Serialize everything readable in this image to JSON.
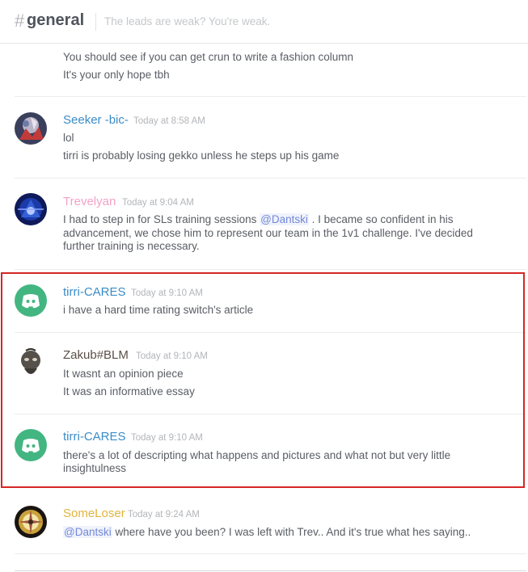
{
  "header": {
    "hash": "#",
    "channel": "general",
    "topic": "The leads are weak? You're weak."
  },
  "colors": {
    "highlight_border": "#d62626",
    "seeker": "#3b8cc7",
    "trevelyan": "#f2a2c7",
    "tirri": "#3b8cc7",
    "zakub": "#5a4e47",
    "someloser": "#e0b43a",
    "mention": "#7289da"
  },
  "messages": [
    {
      "lines": [
        "You should see if you can get crun to write a fashion column",
        "It's your only hope tbh"
      ]
    },
    {
      "username": "Seeker -bic-",
      "timestamp": "Today at 8:58 AM",
      "avatar_icon": "seeker-avatar",
      "lines": [
        "lol",
        "tirri is probably losing gekko unless he steps up his game"
      ]
    },
    {
      "username": "Trevelyan",
      "timestamp": "Today at 9:04 AM",
      "avatar_icon": "trevelyan-avatar",
      "text_pre": "I had to step in for SLs training sessions ",
      "mention": "@Dantski",
      "text_post": " . I became so confident in his",
      "lines_cont": [
        "advancement, we chose him to represent our team in the 1v1 challenge. I've decided",
        "further training is necessary."
      ]
    },
    {
      "username": "tirri-CARES",
      "timestamp": "Today at 9:10 AM",
      "avatar_icon": "discord-logo-icon",
      "lines": [
        "i have a hard time rating switch's article"
      ]
    },
    {
      "username": "Zakub#BLM",
      "timestamp": "Today at 9:10 AM",
      "avatar_icon": "zakub-avatar",
      "lines": [
        "It wasnt an opinion piece",
        "It was an informative essay"
      ]
    },
    {
      "username": "tirri-CARES",
      "timestamp": "Today at 9:10 AM",
      "avatar_icon": "discord-logo-icon",
      "lines": [
        "there's a lot of descripting what happens and pictures and what not but very little",
        "insightulness"
      ]
    },
    {
      "username": "SomeLoser",
      "timestamp": "Today at 9:24 AM",
      "avatar_icon": "someloser-avatar",
      "mention": "@Dantski",
      "text_post": " where have you been? I was left with Trev.. And it's true what hes saying.."
    }
  ]
}
